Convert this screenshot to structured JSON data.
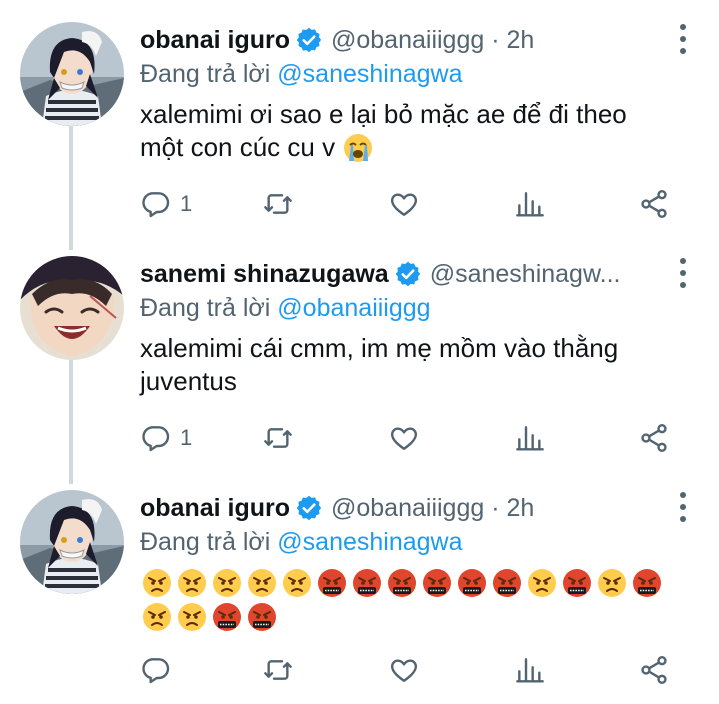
{
  "tweets": [
    {
      "display_name": "obanai iguro",
      "handle": "@obanaiiiggg",
      "time": "2h",
      "reply_prefix": "Đang trả lời",
      "reply_to": "@saneshinagwa",
      "text_line1": "xalemimi ơi sao e lại bỏ mặc ae để đi theo",
      "text_line2": "một con cúc cu v",
      "emoji": "crying-face",
      "reply_count": "1"
    },
    {
      "display_name": "sanemi shinazugawa",
      "handle": "@saneshinagw...",
      "reply_prefix": "Đang trả lời",
      "reply_to": "@obanaiiiggg",
      "text_line1": "xalemimi cái cmm, im mẹ mồm vào thằng",
      "text_line2": "juventus",
      "reply_count": "1"
    },
    {
      "display_name": "obanai iguro",
      "handle": "@obanaiiiggg",
      "time": "2h",
      "reply_prefix": "Đang trả lời",
      "reply_to": "@saneshinagwa",
      "emoji_row1": [
        "angry",
        "angry",
        "angry",
        "angry",
        "angry",
        "cursing",
        "cursing",
        "cursing",
        "cursing",
        "cursing",
        "cursing",
        "angry",
        "cursing",
        "angry",
        "cursing"
      ],
      "emoji_row2": [
        "angry",
        "angry",
        "cursing",
        "cursing"
      ]
    }
  ],
  "icons": [
    "verified-badge-icon",
    "more-icon",
    "reply-icon",
    "retweet-icon",
    "like-icon",
    "analytics-icon",
    "share-icon"
  ],
  "colors": {
    "accent": "#1d9bf0",
    "muted": "#536471",
    "text": "#0f1419",
    "thread_line": "#cfd9de"
  }
}
